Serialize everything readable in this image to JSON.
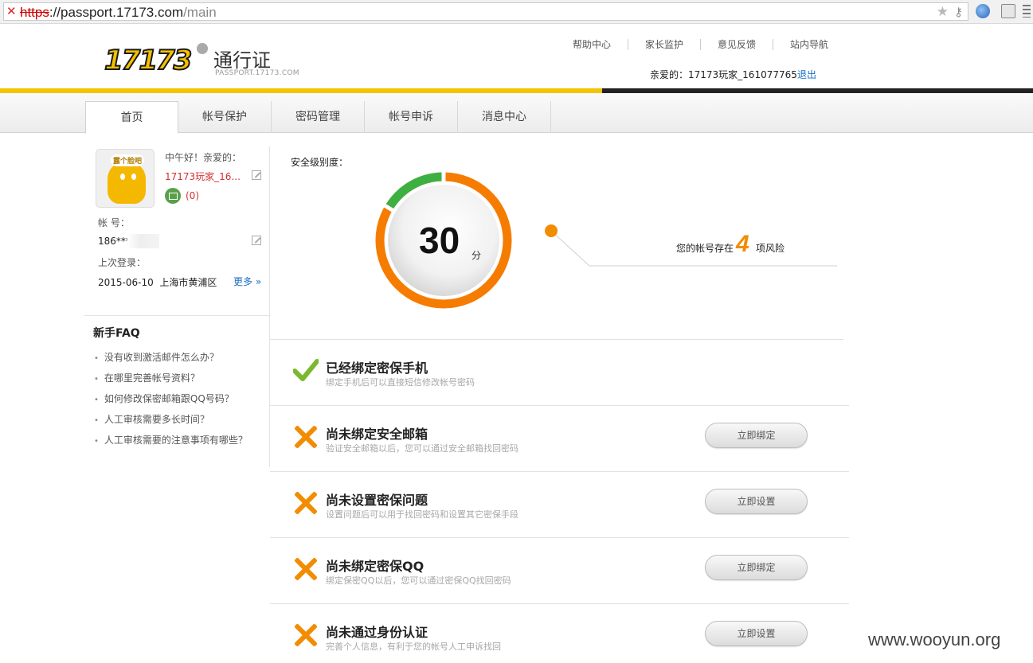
{
  "browser": {
    "url_scheme": "https",
    "url_host": "://passport.17173.com",
    "url_path": "/main",
    "icons": [
      "close-icon",
      "star-icon",
      "key-icon",
      "globe-icon",
      "extension-icon",
      "menu-icon"
    ]
  },
  "header": {
    "logo_text": "17173",
    "title": "通行证",
    "subtitle": "PASSPORT.17173.COM",
    "nav": [
      "帮助中心",
      "家长监护",
      "意见反馈",
      "站内导航"
    ],
    "greeting": "亲爱的：17173玩家_161077765",
    "logout": "退出"
  },
  "tabs": [
    "首页",
    "帐号保护",
    "密码管理",
    "帐号申诉",
    "消息中心"
  ],
  "sidebar": {
    "avatar_bubble": "露个脸吧",
    "hello": "中午好！亲爱的：",
    "username": "17173玩家_16...",
    "mail_count": "(0)",
    "account_label": "帐 号：",
    "account_value": "186****",
    "last_login_label": "上次登录：",
    "last_login_value": "2015-06-10  上海市黄浦区",
    "more": "更多 »",
    "faq_title": "新手FAQ",
    "faq": [
      "没有收到激活邮件怎么办？",
      "在哪里完善帐号资料？",
      "如何修改保密邮箱跟QQ号码？",
      "人工审核需要多长时间？",
      "人工审核需要的注意事项有哪些？"
    ]
  },
  "meter": {
    "label": "安全级别度：",
    "score": "30",
    "unit": "分",
    "score_fraction": 0.3,
    "risk_prefix": "您的帐号存在",
    "risk_count": "4",
    "risk_suffix": "项风险",
    "colors": {
      "ring": "#f57c00",
      "good": "#3cb043"
    }
  },
  "items": [
    {
      "status": "done",
      "title": "已经绑定密保手机",
      "desc": "绑定手机后可以直接短信修改帐号密码",
      "button": ""
    },
    {
      "status": "todo",
      "title": "尚未绑定安全邮箱",
      "desc": "验证安全邮箱以后，您可以通过安全邮箱找回密码",
      "button": "立即绑定"
    },
    {
      "status": "todo",
      "title": "尚未设置密保问题",
      "desc": "设置问题后可以用于找回密码和设置其它密保手段",
      "button": "立即设置"
    },
    {
      "status": "todo",
      "title": "尚未绑定密保QQ",
      "desc": "绑定保密QQ以后，您可以通过密保QQ找回密码",
      "button": "立即绑定"
    },
    {
      "status": "todo",
      "title": "尚未通过身份认证",
      "desc": "完善个人信息，有利于您的帐号人工申诉找回",
      "button": "立即设置"
    }
  ],
  "watermark": "www.wooyun.org"
}
